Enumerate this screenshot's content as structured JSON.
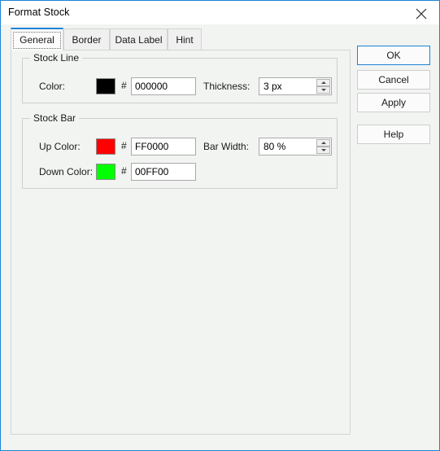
{
  "window": {
    "title": "Format Stock",
    "close_icon": "close-icon",
    "accent_color": "#1c84d4",
    "background_color": "#f2f4f2"
  },
  "tabs": [
    {
      "label": "General",
      "selected": true
    },
    {
      "label": "Border",
      "selected": false
    },
    {
      "label": "Data Label",
      "selected": false
    },
    {
      "label": "Hint",
      "selected": false
    }
  ],
  "general": {
    "stock_line": {
      "title": "Stock Line",
      "color_label": "Color:",
      "color_swatch": "#000000",
      "hash": "#",
      "color_value": "000000",
      "thickness_label": "Thickness:",
      "thickness_value": "3 px"
    },
    "stock_bar": {
      "title": "Stock Bar",
      "up_color_label": "Up Color:",
      "up_color_swatch": "#FF0000",
      "up_hash": "#",
      "up_color_value": "FF0000",
      "down_color_label": "Down Color:",
      "down_color_swatch": "#00FF00",
      "down_hash": "#",
      "down_color_value": "00FF00",
      "bar_width_label": "Bar Width:",
      "bar_width_value": "80 %"
    }
  },
  "buttons": {
    "ok": "OK",
    "cancel": "Cancel",
    "apply": "Apply",
    "help": "Help"
  }
}
